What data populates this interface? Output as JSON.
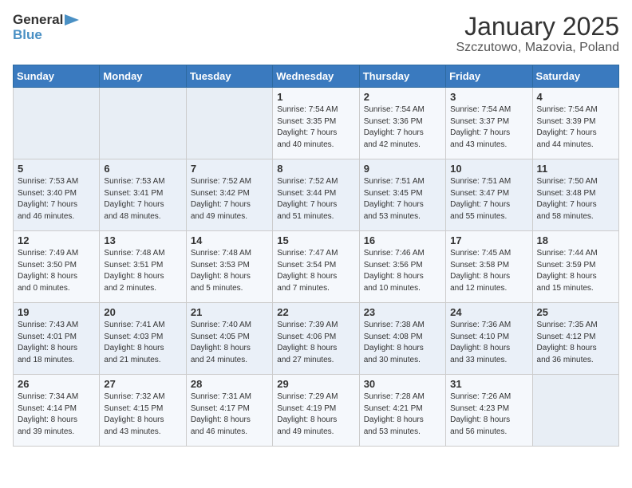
{
  "logo": {
    "text_general": "General",
    "text_blue": "Blue"
  },
  "title": "January 2025",
  "subtitle": "Szczutowo, Mazovia, Poland",
  "headers": [
    "Sunday",
    "Monday",
    "Tuesday",
    "Wednesday",
    "Thursday",
    "Friday",
    "Saturday"
  ],
  "weeks": [
    [
      {
        "day": "",
        "info": ""
      },
      {
        "day": "",
        "info": ""
      },
      {
        "day": "",
        "info": ""
      },
      {
        "day": "1",
        "info": "Sunrise: 7:54 AM\nSunset: 3:35 PM\nDaylight: 7 hours\nand 40 minutes."
      },
      {
        "day": "2",
        "info": "Sunrise: 7:54 AM\nSunset: 3:36 PM\nDaylight: 7 hours\nand 42 minutes."
      },
      {
        "day": "3",
        "info": "Sunrise: 7:54 AM\nSunset: 3:37 PM\nDaylight: 7 hours\nand 43 minutes."
      },
      {
        "day": "4",
        "info": "Sunrise: 7:54 AM\nSunset: 3:39 PM\nDaylight: 7 hours\nand 44 minutes."
      }
    ],
    [
      {
        "day": "5",
        "info": "Sunrise: 7:53 AM\nSunset: 3:40 PM\nDaylight: 7 hours\nand 46 minutes."
      },
      {
        "day": "6",
        "info": "Sunrise: 7:53 AM\nSunset: 3:41 PM\nDaylight: 7 hours\nand 48 minutes."
      },
      {
        "day": "7",
        "info": "Sunrise: 7:52 AM\nSunset: 3:42 PM\nDaylight: 7 hours\nand 49 minutes."
      },
      {
        "day": "8",
        "info": "Sunrise: 7:52 AM\nSunset: 3:44 PM\nDaylight: 7 hours\nand 51 minutes."
      },
      {
        "day": "9",
        "info": "Sunrise: 7:51 AM\nSunset: 3:45 PM\nDaylight: 7 hours\nand 53 minutes."
      },
      {
        "day": "10",
        "info": "Sunrise: 7:51 AM\nSunset: 3:47 PM\nDaylight: 7 hours\nand 55 minutes."
      },
      {
        "day": "11",
        "info": "Sunrise: 7:50 AM\nSunset: 3:48 PM\nDaylight: 7 hours\nand 58 minutes."
      }
    ],
    [
      {
        "day": "12",
        "info": "Sunrise: 7:49 AM\nSunset: 3:50 PM\nDaylight: 8 hours\nand 0 minutes."
      },
      {
        "day": "13",
        "info": "Sunrise: 7:48 AM\nSunset: 3:51 PM\nDaylight: 8 hours\nand 2 minutes."
      },
      {
        "day": "14",
        "info": "Sunrise: 7:48 AM\nSunset: 3:53 PM\nDaylight: 8 hours\nand 5 minutes."
      },
      {
        "day": "15",
        "info": "Sunrise: 7:47 AM\nSunset: 3:54 PM\nDaylight: 8 hours\nand 7 minutes."
      },
      {
        "day": "16",
        "info": "Sunrise: 7:46 AM\nSunset: 3:56 PM\nDaylight: 8 hours\nand 10 minutes."
      },
      {
        "day": "17",
        "info": "Sunrise: 7:45 AM\nSunset: 3:58 PM\nDaylight: 8 hours\nand 12 minutes."
      },
      {
        "day": "18",
        "info": "Sunrise: 7:44 AM\nSunset: 3:59 PM\nDaylight: 8 hours\nand 15 minutes."
      }
    ],
    [
      {
        "day": "19",
        "info": "Sunrise: 7:43 AM\nSunset: 4:01 PM\nDaylight: 8 hours\nand 18 minutes."
      },
      {
        "day": "20",
        "info": "Sunrise: 7:41 AM\nSunset: 4:03 PM\nDaylight: 8 hours\nand 21 minutes."
      },
      {
        "day": "21",
        "info": "Sunrise: 7:40 AM\nSunset: 4:05 PM\nDaylight: 8 hours\nand 24 minutes."
      },
      {
        "day": "22",
        "info": "Sunrise: 7:39 AM\nSunset: 4:06 PM\nDaylight: 8 hours\nand 27 minutes."
      },
      {
        "day": "23",
        "info": "Sunrise: 7:38 AM\nSunset: 4:08 PM\nDaylight: 8 hours\nand 30 minutes."
      },
      {
        "day": "24",
        "info": "Sunrise: 7:36 AM\nSunset: 4:10 PM\nDaylight: 8 hours\nand 33 minutes."
      },
      {
        "day": "25",
        "info": "Sunrise: 7:35 AM\nSunset: 4:12 PM\nDaylight: 8 hours\nand 36 minutes."
      }
    ],
    [
      {
        "day": "26",
        "info": "Sunrise: 7:34 AM\nSunset: 4:14 PM\nDaylight: 8 hours\nand 39 minutes."
      },
      {
        "day": "27",
        "info": "Sunrise: 7:32 AM\nSunset: 4:15 PM\nDaylight: 8 hours\nand 43 minutes."
      },
      {
        "day": "28",
        "info": "Sunrise: 7:31 AM\nSunset: 4:17 PM\nDaylight: 8 hours\nand 46 minutes."
      },
      {
        "day": "29",
        "info": "Sunrise: 7:29 AM\nSunset: 4:19 PM\nDaylight: 8 hours\nand 49 minutes."
      },
      {
        "day": "30",
        "info": "Sunrise: 7:28 AM\nSunset: 4:21 PM\nDaylight: 8 hours\nand 53 minutes."
      },
      {
        "day": "31",
        "info": "Sunrise: 7:26 AM\nSunset: 4:23 PM\nDaylight: 8 hours\nand 56 minutes."
      },
      {
        "day": "",
        "info": ""
      }
    ]
  ]
}
